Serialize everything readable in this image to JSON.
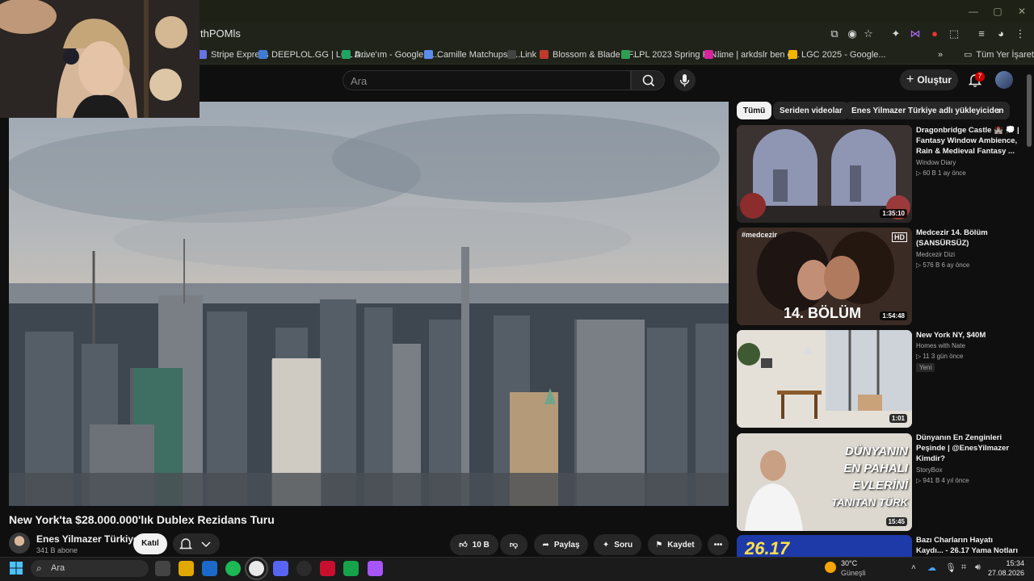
{
  "browser": {
    "url_fragment": "thPOMls",
    "bookmarks": [
      "Stripe Express",
      "DEEPLOL.GG | LOL A...",
      "Drive'ım - Google D...",
      "Camille Matchups -...",
      "Link",
      "Blossom & Blade - F...",
      "LPL 2023 Spring FIN...",
      "lime | arkdslr ben g...",
      "LGC 2025 - Google..."
    ],
    "all_bookmarks_label": "Tüm Yer İşaretleri",
    "bookmark_colors": [
      "#6772e5",
      "#3f7bd6",
      "#1fa463",
      "#5b8def",
      "#444444",
      "#c0392b",
      "#2e9e55",
      "#d6249f",
      "#f4b400"
    ]
  },
  "youtube": {
    "search_placeholder": "Ara",
    "create_label": "Oluştur",
    "notification_count": "7",
    "chips": [
      "Tümü",
      "Seriden videolar",
      "Enes Yilmazer Türkiye adlı yükleyiciden"
    ],
    "video": {
      "title": "New York'ta $28.000.000'lık Dublex Rezidans Turu",
      "channel": "Enes Yilmazer Türkiye",
      "subscribers": "341 B abone",
      "join_label": "Katıl",
      "likes": "10 B",
      "share_label": "Paylaş",
      "ask_label": "Soru",
      "save_label": "Kaydet"
    },
    "related": [
      {
        "title": "Dragonbridge Castle 🏰 💭 | Fantasy Window Ambience, Rain & Medieval Fantasy ...",
        "channel": "Window Diary",
        "meta": "▷ 60 B   1 ay önce",
        "duration": "1:35:10",
        "badge": ""
      },
      {
        "title": "Medcezir 14. Bölüm (SANSÜRSÜZ)",
        "channel": "Medcezir Dizi",
        "meta": "▷ 576 B   6 ay önce",
        "duration": "1:54:48",
        "badge": "",
        "overlay": "14. BÖLÜM",
        "hd": "HD",
        "brand": "#medcezir"
      },
      {
        "title": "New York NY, $40M",
        "channel": "Homes with Nate",
        "meta": "▷ 11   3 gün önce",
        "duration": "1:01",
        "badge": "Yeni"
      },
      {
        "title": "Dünyanın En Zenginleri Peşinde | @EnesYilmazer Kimdir?",
        "channel": "StoryBox",
        "meta": "▷ 941 B   4 yıl önce",
        "duration": "15:45",
        "badge": "",
        "overlay_lines": [
          "DÜNYANIN",
          "EN PAHALI",
          "EVLERİNİ",
          "TANITAN TÜRK"
        ]
      },
      {
        "title": "Bazı Charların Hayatı Kaydı... - 26.17 Yama Notları",
        "channel": "",
        "meta": "",
        "duration": "",
        "badge": "",
        "overlay": "26.17"
      }
    ]
  },
  "taskbar": {
    "search_placeholder": "Ara",
    "weather_temp": "30°C",
    "weather_desc": "Güneşli",
    "time": "15:34",
    "date": "27.08.2026",
    "app_colors": [
      "#444",
      "#e0a800",
      "#1b6ac9",
      "#1db954",
      "#e8e8e8",
      "#5865f2",
      "#2b2b2b",
      "#c8102e",
      "#16a34a",
      "#a855f7"
    ]
  }
}
